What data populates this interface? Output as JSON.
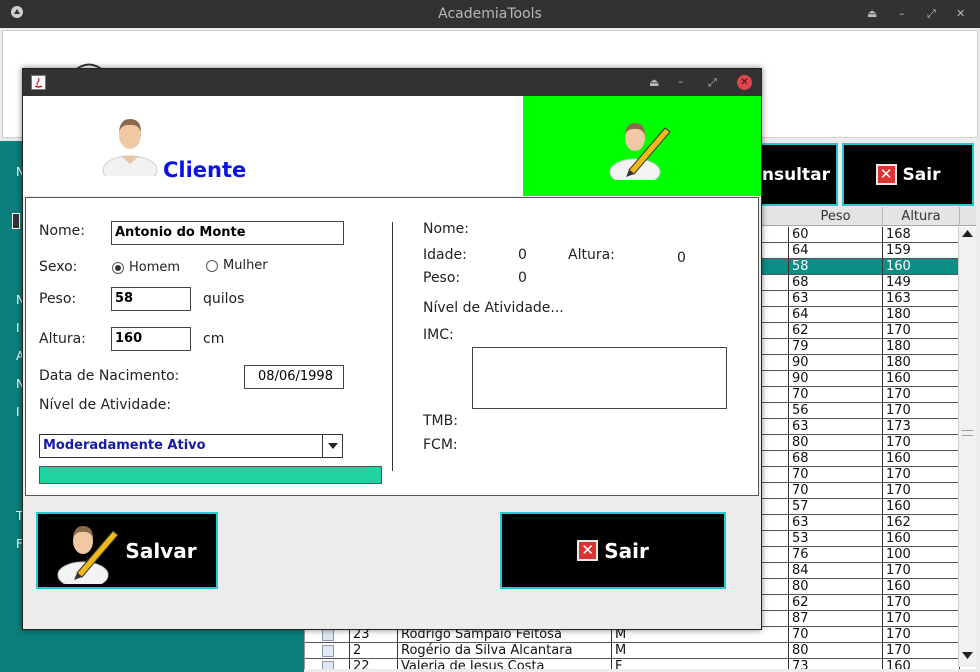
{
  "main_window": {
    "title": "AcademiaTools",
    "titlebar_buttons": [
      "⏏",
      "–",
      "⤢",
      "✕"
    ],
    "consultar_label": "Consultar",
    "sair_label": "Sair",
    "left_panel_letters": [
      "N",
      "N",
      "I",
      "A",
      "N",
      "I",
      "T",
      "F"
    ],
    "table": {
      "columns": [
        "Peso",
        "Altura"
      ],
      "top_rows": [
        {
          "peso": "60",
          "altura": "168"
        },
        {
          "peso": "64",
          "altura": "159"
        },
        {
          "peso": "58",
          "altura": "160"
        },
        {
          "peso": "68",
          "altura": "149"
        },
        {
          "peso": "63",
          "altura": "163"
        },
        {
          "peso": "64",
          "altura": "180"
        },
        {
          "peso": "62",
          "altura": "170"
        },
        {
          "peso": "79",
          "altura": "180"
        },
        {
          "peso": "90",
          "altura": "180"
        },
        {
          "peso": "90",
          "altura": "160"
        },
        {
          "peso": "70",
          "altura": "170"
        },
        {
          "peso": "56",
          "altura": "170"
        },
        {
          "peso": "63",
          "altura": "173"
        },
        {
          "peso": "80",
          "altura": "170"
        },
        {
          "peso": "68",
          "altura": "160"
        },
        {
          "peso": "70",
          "altura": "170"
        },
        {
          "peso": "70",
          "altura": "170"
        },
        {
          "peso": "57",
          "altura": "160"
        },
        {
          "peso": "63",
          "altura": "162"
        },
        {
          "peso": "53",
          "altura": "160"
        },
        {
          "peso": "76",
          "altura": "100"
        },
        {
          "peso": "84",
          "altura": "170"
        },
        {
          "peso": "80",
          "altura": "160"
        },
        {
          "peso": "62",
          "altura": "170"
        },
        {
          "peso": "87",
          "altura": "170"
        }
      ],
      "bottom_rows": [
        {
          "id": "23",
          "nome": "Rodrigo Sampaio Feitosa",
          "sexo": "M",
          "peso": "70",
          "altura": "170"
        },
        {
          "id": "2",
          "nome": "Rogério da Silva Alcantara",
          "sexo": "M",
          "peso": "80",
          "altura": "170"
        },
        {
          "id": "22",
          "nome": "Valeria de Jesus Costa",
          "sexo": "F",
          "peso": "73",
          "altura": "160"
        }
      ]
    }
  },
  "dialog": {
    "title": "Cliente",
    "titlebar_buttons": [
      "⏏",
      "–",
      "⤢",
      "✕"
    ],
    "form": {
      "nome_label": "Nome:",
      "nome_value": "Antonio do Monte",
      "sexo_label": "Sexo:",
      "sexo_options": [
        "Homem",
        "Mulher"
      ],
      "sexo_selected": "Homem",
      "peso_label": "Peso:",
      "peso_value": "58",
      "peso_unit": "quilos",
      "altura_label": "Altura:",
      "altura_value": "160",
      "altura_unit": "cm",
      "nascimento_label": "Data de Nacimento:",
      "nascimento_value": "08/06/1998",
      "atividade_label": "Nível de Atividade:",
      "atividade_value": "Moderadamente Ativo",
      "progress_fraction": 1.0
    },
    "summary": {
      "nome_label": "Nome:",
      "idade_label": "Idade:",
      "idade_value": "0",
      "altura_label": "Altura:",
      "altura_value": "0",
      "peso_label": "Peso:",
      "peso_value": "0",
      "atividade_label": "Nível de Atividade...",
      "imc_label": "IMC:",
      "tmb_label": "TMB:",
      "fcm_label": "FCM:"
    },
    "salvar_label": "Salvar",
    "sair_label": "Sair"
  },
  "colors": {
    "accent_teal": "#0b7f7b",
    "header_green": "#00ff00",
    "title_blue": "#0a10e6",
    "button_border": "#27c8d2",
    "progress": "#1fd4a0"
  },
  "icons": [
    "user-avatar-icon",
    "user-edit-icon",
    "close-x-icon",
    "java-app-icon",
    "combo-arrow-icon",
    "checkbox-icon"
  ]
}
